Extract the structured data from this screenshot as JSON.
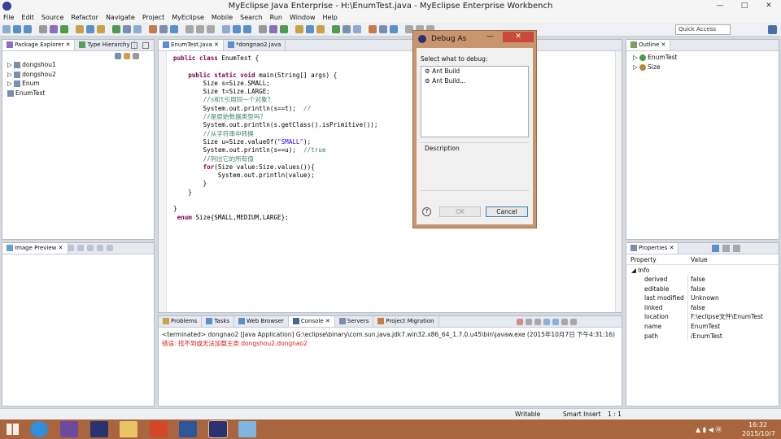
{
  "window": {
    "title": "MyEclipse Java Enterprise - H:\\EnumTest.java - MyEclipse Enterprise Workbench"
  },
  "menu": [
    "File",
    "Edit",
    "Source",
    "Refactor",
    "Navigate",
    "Project",
    "MyEclipse",
    "Mobile",
    "Search",
    "Run",
    "Window",
    "Help"
  ],
  "quick_access": "Quick Access",
  "package_explorer": {
    "tabs": [
      "Package Explorer",
      "Type Hierarchy"
    ],
    "items": [
      "dongshou1",
      "dongshou2",
      "Enum",
      "EnumTest"
    ]
  },
  "editor": {
    "tabs": [
      "EnumTest.java",
      "*dongnao2.java"
    ],
    "lines": [
      {
        "parts": [
          [
            "kw",
            "public class "
          ],
          [
            "n",
            "EnumTest {"
          ]
        ]
      },
      {
        "parts": [
          [
            "n",
            ""
          ]
        ]
      },
      {
        "parts": [
          [
            "kw",
            "    public static void "
          ],
          [
            "n",
            "main(String[] args) {"
          ]
        ]
      },
      {
        "parts": [
          [
            "n",
            "        Size s=Size.SMALL;"
          ]
        ]
      },
      {
        "parts": [
          [
            "n",
            "        Size t=Size.LARGE;"
          ]
        ]
      },
      {
        "parts": [
          [
            "cm",
            "        //s和t引用同一个对象？"
          ]
        ]
      },
      {
        "parts": [
          [
            "n",
            "        System.out.println(s==t);  "
          ],
          [
            "cm",
            "//"
          ]
        ]
      },
      {
        "parts": [
          [
            "cm",
            "        //是原始数据类型吗？"
          ]
        ]
      },
      {
        "parts": [
          [
            "n",
            "        System.out.println(s.getClass().isPrimitive());"
          ]
        ]
      },
      {
        "parts": [
          [
            "cm",
            "        //从字符串中转换"
          ]
        ]
      },
      {
        "parts": [
          [
            "n",
            "        Size u=Size.valueOf("
          ],
          [
            "str",
            "\"SMALL\""
          ],
          [
            "n",
            ");"
          ]
        ]
      },
      {
        "parts": [
          [
            "n",
            "        System.out.println(s==u);  "
          ],
          [
            "cm",
            "//true"
          ]
        ]
      },
      {
        "parts": [
          [
            "cm",
            "        //列出它的所有值"
          ]
        ]
      },
      {
        "parts": [
          [
            "kw",
            "        for"
          ],
          [
            "n",
            "(Size value:Size.values()){"
          ]
        ]
      },
      {
        "parts": [
          [
            "n",
            "            System.out.println(value);"
          ]
        ]
      },
      {
        "parts": [
          [
            "n",
            "        }"
          ]
        ]
      },
      {
        "parts": [
          [
            "n",
            "    }"
          ]
        ]
      },
      {
        "parts": [
          [
            "n",
            ""
          ]
        ]
      },
      {
        "parts": [
          [
            "n",
            "}"
          ]
        ]
      },
      {
        "parts": [
          [
            "kw",
            " enum "
          ],
          [
            "n",
            "Size{SMALL,MEDIUM,LARGE};"
          ]
        ]
      }
    ]
  },
  "outline": {
    "tab": "Outline",
    "items": [
      "EnumTest",
      "Size"
    ]
  },
  "image_preview": {
    "tab": "Image Preview"
  },
  "debug_dialog": {
    "title": "Debug As",
    "prompt": "Select what to debug:",
    "options": [
      "Ant Build",
      "Ant Build..."
    ],
    "description_label": "Description",
    "ok_label": "OK",
    "cancel_label": "Cancel"
  },
  "console": {
    "tabs": [
      "Problems",
      "Tasks",
      "Web Browser",
      "Console",
      "Servers",
      "Project Migration"
    ],
    "terminated_line": "<terminated> dongnao2 [Java Application] G:\\eclipse\\binary\\com.sun.java.jdk7.win32.x86_64_1.7.0.u45\\bin\\javaw.exe (2015年10月7日 下午4:31:16)",
    "error_line": "错误: 找不到或无法加载主类 dongshou2.dongnao2"
  },
  "properties": {
    "tab": "Properties",
    "col_property": "Property",
    "col_value": "Value",
    "group": "Info",
    "rows": [
      {
        "k": "derived",
        "v": "false"
      },
      {
        "k": "editable",
        "v": "false"
      },
      {
        "k": "last modified",
        "v": "Unknown"
      },
      {
        "k": "linked",
        "v": "false"
      },
      {
        "k": "location",
        "v": "F:\\eclipse文件\\EnumTest"
      },
      {
        "k": "name",
        "v": "EnumTest"
      },
      {
        "k": "path",
        "v": "/EnumTest"
      }
    ]
  },
  "status": {
    "writable": "Writable",
    "insert_mode": "Smart Insert",
    "position": "1 : 1"
  },
  "taskbar": {
    "time": "16:32",
    "date": "2015/10/7"
  },
  "colors": {
    "taskbar": "#a9653d",
    "keyword": "#7f0055",
    "comment": "#3f7f5f",
    "string": "#2a00ff",
    "error": "#e01b1b"
  }
}
